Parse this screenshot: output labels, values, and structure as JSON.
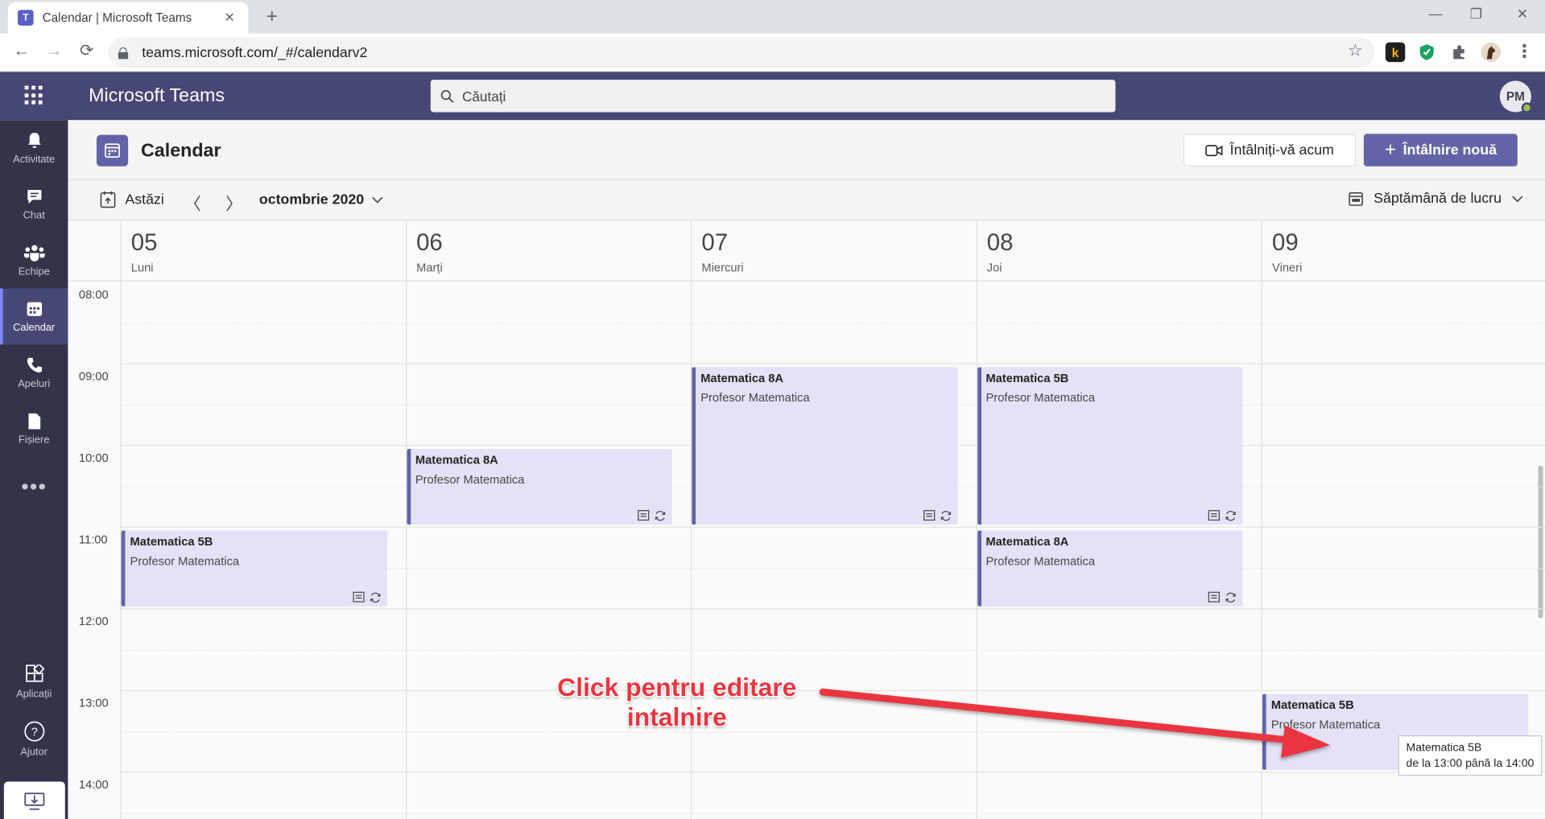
{
  "browser": {
    "tab_title": "Calendar | Microsoft Teams",
    "favicon_letter": "T",
    "url": "teams.microsoft.com/_#/calendarv2",
    "extension_k": "k"
  },
  "header": {
    "app_name": "Microsoft Teams",
    "search_placeholder": "Căutați",
    "avatar_initials": "PM"
  },
  "rail": {
    "items": [
      {
        "label": "Activitate",
        "icon": "bell-icon"
      },
      {
        "label": "Chat",
        "icon": "chat-icon"
      },
      {
        "label": "Echipe",
        "icon": "teams-icon"
      },
      {
        "label": "Calendar",
        "icon": "calendar-icon",
        "active": true
      },
      {
        "label": "Apeluri",
        "icon": "phone-icon"
      },
      {
        "label": "Fișiere",
        "icon": "file-icon"
      }
    ],
    "more": "•••",
    "apps_label": "Aplicații",
    "help_label": "Ajutor"
  },
  "calendar": {
    "title": "Calendar",
    "meet_now": "Întâlniți-vă acum",
    "new_meeting": "Întâlnire nouă",
    "today": "Astăzi",
    "month": "octombrie 2020",
    "view": "Săptămână de lucru",
    "days": [
      {
        "num": "05",
        "name": "Luni"
      },
      {
        "num": "06",
        "name": "Marți"
      },
      {
        "num": "07",
        "name": "Miercuri"
      },
      {
        "num": "08",
        "name": "Joi"
      },
      {
        "num": "09",
        "name": "Vineri"
      }
    ],
    "hours": [
      "08:00",
      "09:00",
      "10:00",
      "11:00",
      "12:00",
      "13:00",
      "14:00"
    ],
    "events": [
      {
        "title": "Matematica 8A",
        "organizer": "Profesor Matematica",
        "day": 1,
        "start": "10:00",
        "end": "11:00",
        "icons": true
      },
      {
        "title": "Matematica 8A",
        "organizer": "Profesor Matematica",
        "day": 2,
        "start": "09:00",
        "end": "11:00",
        "icons": true
      },
      {
        "title": "Matematica 5B",
        "organizer": "Profesor Matematica",
        "day": 3,
        "start": "09:00",
        "end": "11:00",
        "icons": true
      },
      {
        "title": "Matematica 5B",
        "organizer": "Profesor Matematica",
        "day": 0,
        "start": "11:00",
        "end": "12:00",
        "icons": true
      },
      {
        "title": "Matematica 8A",
        "organizer": "Profesor Matematica",
        "day": 3,
        "start": "11:00",
        "end": "12:00",
        "icons": true
      },
      {
        "title": "Matematica 5B",
        "organizer": "Profesor Matematica",
        "day": 4,
        "start": "13:00",
        "end": "14:00",
        "icons": false
      }
    ]
  },
  "tooltip": {
    "line1": "Matematica 5B",
    "line2": "de la 13:00 până la 14:00"
  },
  "annotation": {
    "line1": "Click pentru editare",
    "line2": "intalnire",
    "color": "#e8353f"
  },
  "colors": {
    "teams_purple": "#464775",
    "rail": "#33344a",
    "accent": "#6264a7",
    "event_bg": "#e3e2f6"
  }
}
